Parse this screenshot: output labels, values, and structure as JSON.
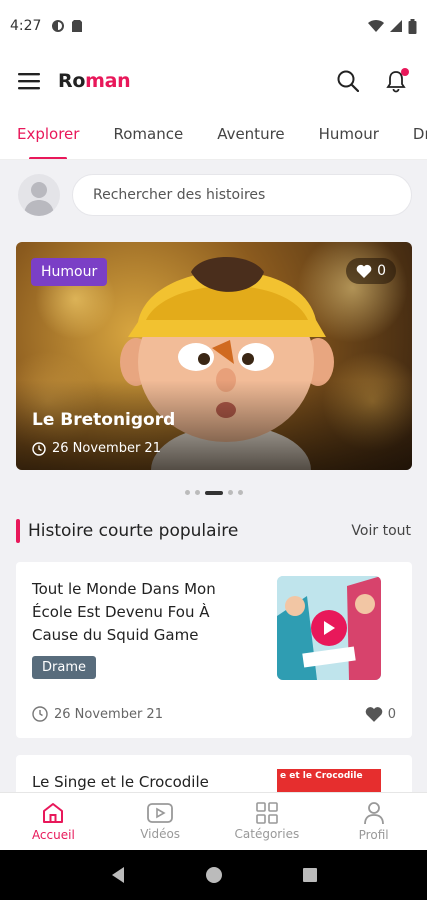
{
  "status": {
    "time": "4:27"
  },
  "app": {
    "brand_part1": "Ro",
    "brand_part2": "man"
  },
  "tabs": [
    {
      "label": "Explorer",
      "active": true
    },
    {
      "label": "Romance"
    },
    {
      "label": "Aventure"
    },
    {
      "label": "Humour"
    },
    {
      "label": "Dr"
    }
  ],
  "search": {
    "placeholder": "Rechercher des histoires"
  },
  "featured": {
    "category": "Humour",
    "likes": "0",
    "title": "Le Bretonigord",
    "date": "26 November 21"
  },
  "carousel": {
    "count": 5,
    "active_index": 2
  },
  "section": {
    "title": "Histoire courte populaire",
    "see_all": "Voir tout"
  },
  "stories": [
    {
      "title": "Tout le Monde Dans Mon École Est Devenu Fou À Cause du Squid Game",
      "tag": "Drame",
      "date": "26 November 21",
      "likes": "0"
    },
    {
      "title": "Le Singe et le Crocodile",
      "thumb_text": "e et le Crocodile"
    }
  ],
  "bottom_nav": [
    {
      "label": "Accueil",
      "icon": "home-icon",
      "active": true
    },
    {
      "label": "Vidéos",
      "icon": "video-icon"
    },
    {
      "label": "Catégories",
      "icon": "grid-icon"
    },
    {
      "label": "Profil",
      "icon": "profile-icon"
    }
  ],
  "colors": {
    "accent": "#e8185a",
    "badge": "#7b3fc6",
    "tag": "#586c7c"
  }
}
